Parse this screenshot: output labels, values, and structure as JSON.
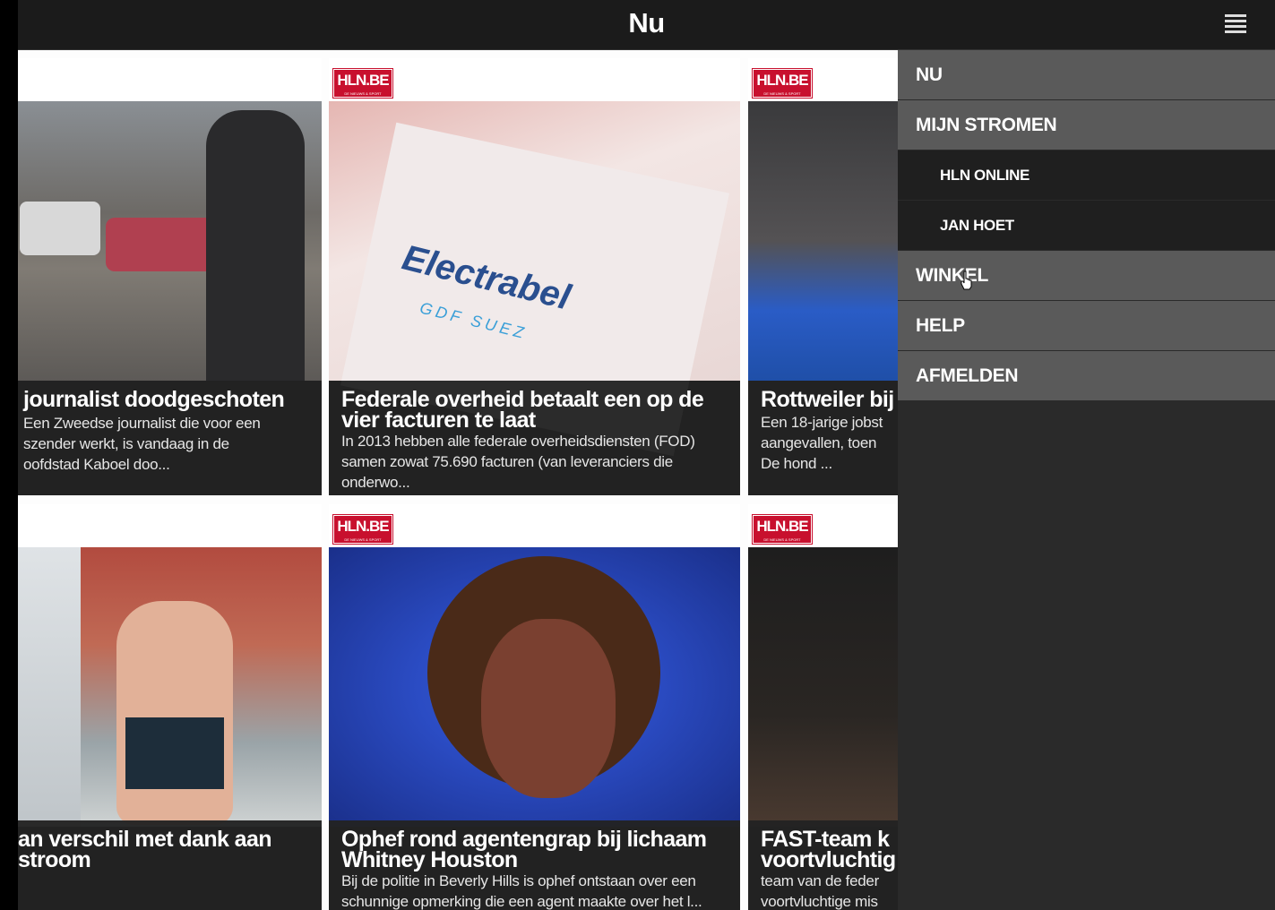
{
  "header": {
    "title": "Nu"
  },
  "icons": {
    "menu": "hamburger-menu-icon",
    "cursor": "hand-cursor-icon"
  },
  "logo_text": "HLN.BE",
  "logo_sub": "DE NIEUWS & SPORT",
  "cards": [
    {
      "headline": "journalist doodgeschoten",
      "summary": "Een Zweedse journalist die voor een\nszender werkt, is vandaag in de\noofdstad Kaboel doo..."
    },
    {
      "headline": "Federale overheid betaalt een op de vier facturen te laat",
      "summary": "In 2013 hebben alle federale overheidsdiensten (FOD) samen zowat 75.690 facturen (van leveranciers die onderwo..."
    },
    {
      "headline": "Rottweiler bij",
      "summary": "Een 18-jarige jobst\naangevallen, toen\nDe hond ..."
    },
    {
      "headline": "an verschil met dank aan\nstroom",
      "summary": ""
    },
    {
      "headline": "Ophef rond agentengrap bij lichaam Whitney Houston",
      "summary": "Bij de politie in Beverly Hills is ophef ontstaan over een schunnige opmerking die een agent maakte over het l..."
    },
    {
      "headline": "FAST-team k\nvoortvluchtig",
      "summary": "team van de feder\nvoortvluchtige mis"
    }
  ],
  "menu": {
    "items": [
      {
        "label": "NU",
        "level": "top"
      },
      {
        "label": "MIJN STROMEN",
        "level": "top"
      },
      {
        "label": "HLN ONLINE",
        "level": "sub"
      },
      {
        "label": "JAN HOET",
        "level": "sub"
      },
      {
        "label": "WINKEL",
        "level": "top"
      },
      {
        "label": "HELP",
        "level": "top"
      },
      {
        "label": "AFMELDEN",
        "level": "top"
      }
    ]
  },
  "colors": {
    "topbar": "#1b1b1b",
    "menu_item": "#5a5a5a",
    "submenu_item": "#1f1f1f",
    "logo_red": "#c8102e"
  }
}
